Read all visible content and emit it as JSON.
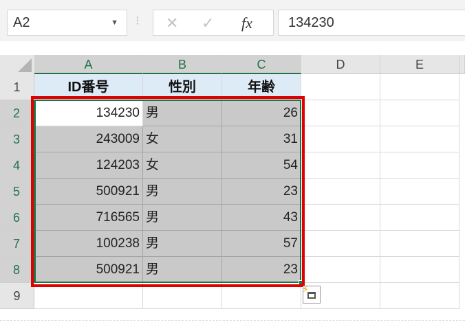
{
  "formula_bar": {
    "name_box": "A2",
    "dropdown_icon": "▼",
    "cancel_icon": "✕",
    "enter_icon": "✓",
    "fx_label": "fx",
    "content": "134230"
  },
  "columns": [
    "A",
    "B",
    "C",
    "D",
    "E"
  ],
  "rows": [
    "1",
    "2",
    "3",
    "4",
    "5",
    "6",
    "7",
    "8",
    "9"
  ],
  "header": {
    "a": "ID番号",
    "b": "性別",
    "c": "年齢"
  },
  "data": [
    {
      "id": "134230",
      "sex": "男",
      "age": "26"
    },
    {
      "id": "243009",
      "sex": "女",
      "age": "31"
    },
    {
      "id": "124203",
      "sex": "女",
      "age": "54"
    },
    {
      "id": "500921",
      "sex": "男",
      "age": "23"
    },
    {
      "id": "716565",
      "sex": "男",
      "age": "43"
    },
    {
      "id": "100238",
      "sex": "男",
      "age": "57"
    },
    {
      "id": "500921",
      "sex": "男",
      "age": "23"
    }
  ],
  "colors": {
    "selection_border": "#217346",
    "highlight_box": "#e00000",
    "header_fill": "#ddebf7"
  }
}
